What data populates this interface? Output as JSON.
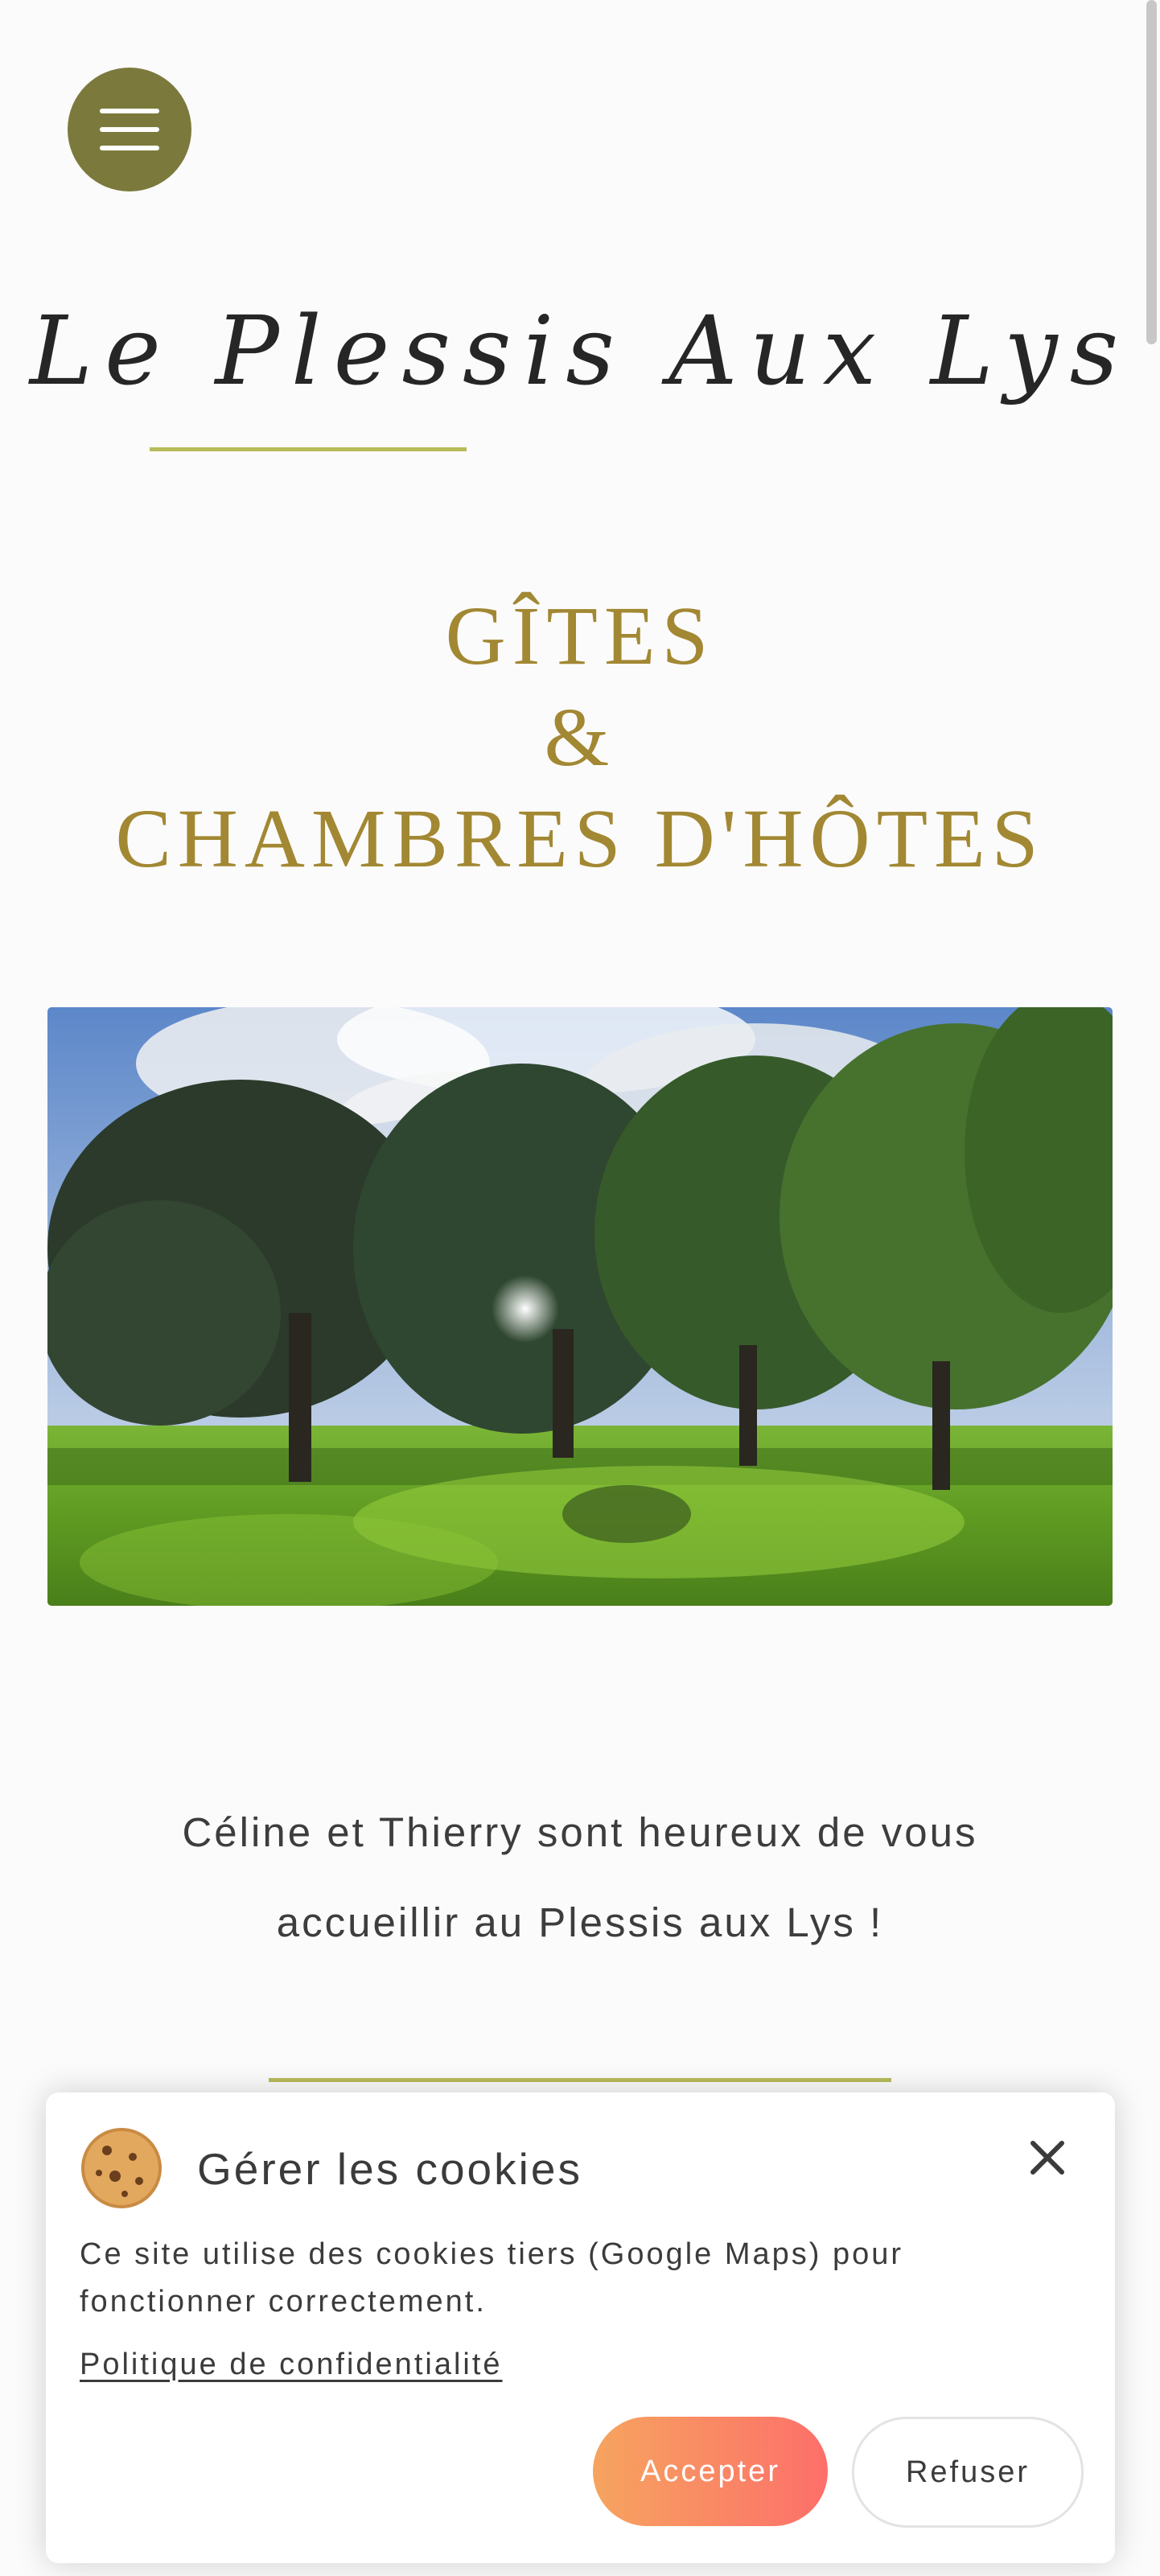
{
  "header": {
    "menu_icon": "hamburger-menu-icon",
    "brand_title": "Le Plessis Aux Lys"
  },
  "hero": {
    "heading_line1": "GÎTES",
    "heading_line2": "&",
    "heading_line3": "CHAMBRES D'HÔTES",
    "image_icon": "park-trees-photo"
  },
  "welcome": {
    "text": "Céline et Thierry sont heureux de vous accueillir au Plessis aux Lys !"
  },
  "cookie_banner": {
    "icon": "cookie-icon",
    "title": "Gérer les cookies",
    "description": "Ce site utilise des cookies tiers (Google Maps) pour fonctionner correctement.",
    "privacy_link": "Politique de confidentialité",
    "accept_label": "Accepter",
    "refuse_label": "Refuser",
    "close_icon": "close-icon"
  },
  "colors": {
    "accent_olive": "#7b7a3c",
    "heading_gold": "#a28833",
    "divider_green": "#b7bb5c",
    "accept_gradient_start": "#f6a45f",
    "accept_gradient_end": "#fd6f6a"
  }
}
